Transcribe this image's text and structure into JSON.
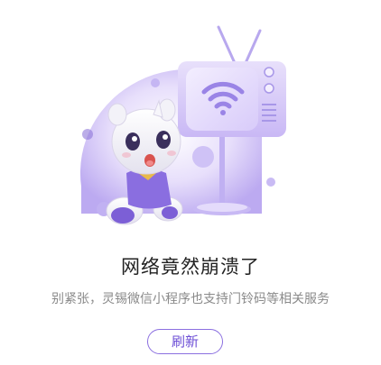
{
  "error": {
    "title": "网络竟然崩溃了",
    "message": "别紧张，灵锡微信小程序也支持门铃码等相关服务",
    "refresh_label": "刷新"
  },
  "colors": {
    "accent": "#6d4fd6",
    "accent_light": "#c9b8f5",
    "title": "#222222",
    "message": "#8a8a8a"
  },
  "icons": [
    "wifi-icon",
    "tv-icon",
    "rhino-mascot-icon"
  ]
}
